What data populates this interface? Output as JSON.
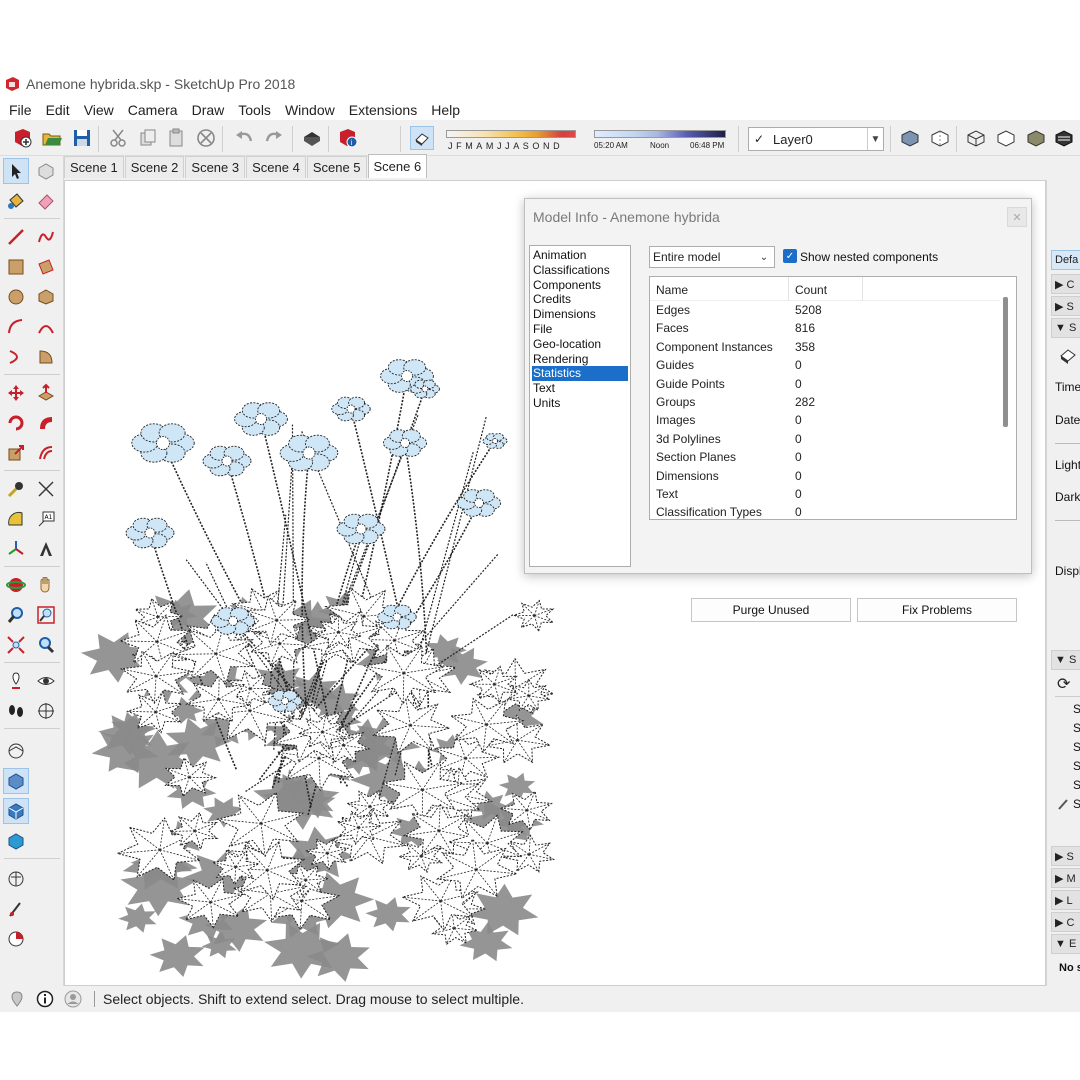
{
  "window": {
    "title": "Anemone hybrida.skp - SketchUp Pro 2018"
  },
  "menu": [
    "File",
    "Edit",
    "View",
    "Camera",
    "Draw",
    "Tools",
    "Window",
    "Extensions",
    "Help"
  ],
  "toolbar": {
    "month_letters": "JFMAMJJASOND",
    "time_start": "05:20 AM",
    "time_noon": "Noon",
    "time_end": "06:48 PM",
    "layer": "Layer0",
    "layer_check": "✓"
  },
  "scenes": [
    "Scene 1",
    "Scene 2",
    "Scene 3",
    "Scene 4",
    "Scene 5",
    "Scene 6"
  ],
  "active_scene": "Scene 6",
  "dialog": {
    "title": "Model Info - Anemone hybrida",
    "categories": [
      "Animation",
      "Classifications",
      "Components",
      "Credits",
      "Dimensions",
      "File",
      "Geo-location",
      "Rendering",
      "Statistics",
      "Text",
      "Units"
    ],
    "selected_category": "Statistics",
    "scope": "Entire model",
    "show_nested_label": "Show nested components",
    "show_nested_checked": true,
    "table_header": {
      "name": "Name",
      "count": "Count"
    },
    "rows": [
      {
        "name": "Edges",
        "count": "5208"
      },
      {
        "name": "Faces",
        "count": "816"
      },
      {
        "name": "Component Instances",
        "count": "358"
      },
      {
        "name": "Guides",
        "count": "0"
      },
      {
        "name": "Guide Points",
        "count": "0"
      },
      {
        "name": "Groups",
        "count": "282"
      },
      {
        "name": "Images",
        "count": "0"
      },
      {
        "name": "3d Polylines",
        "count": "0"
      },
      {
        "name": "Section Planes",
        "count": "0"
      },
      {
        "name": "Dimensions",
        "count": "0"
      },
      {
        "name": "Text",
        "count": "0"
      },
      {
        "name": "Classification Types",
        "count": "0"
      }
    ],
    "purge_label": "Purge Unused",
    "fix_label": "Fix Problems"
  },
  "right_tray": {
    "top_label": "Defa",
    "time_label": "Time",
    "date_label": "Date",
    "light_label": "Light",
    "dark_label": "Dark",
    "display_label": "Displ",
    "bottom_label": "No s"
  },
  "status": {
    "text": "Select objects. Shift to extend select. Drag mouse to select multiple."
  },
  "colors": {
    "accent": "#1b6fc8",
    "sketchup_red": "#c8202a"
  }
}
